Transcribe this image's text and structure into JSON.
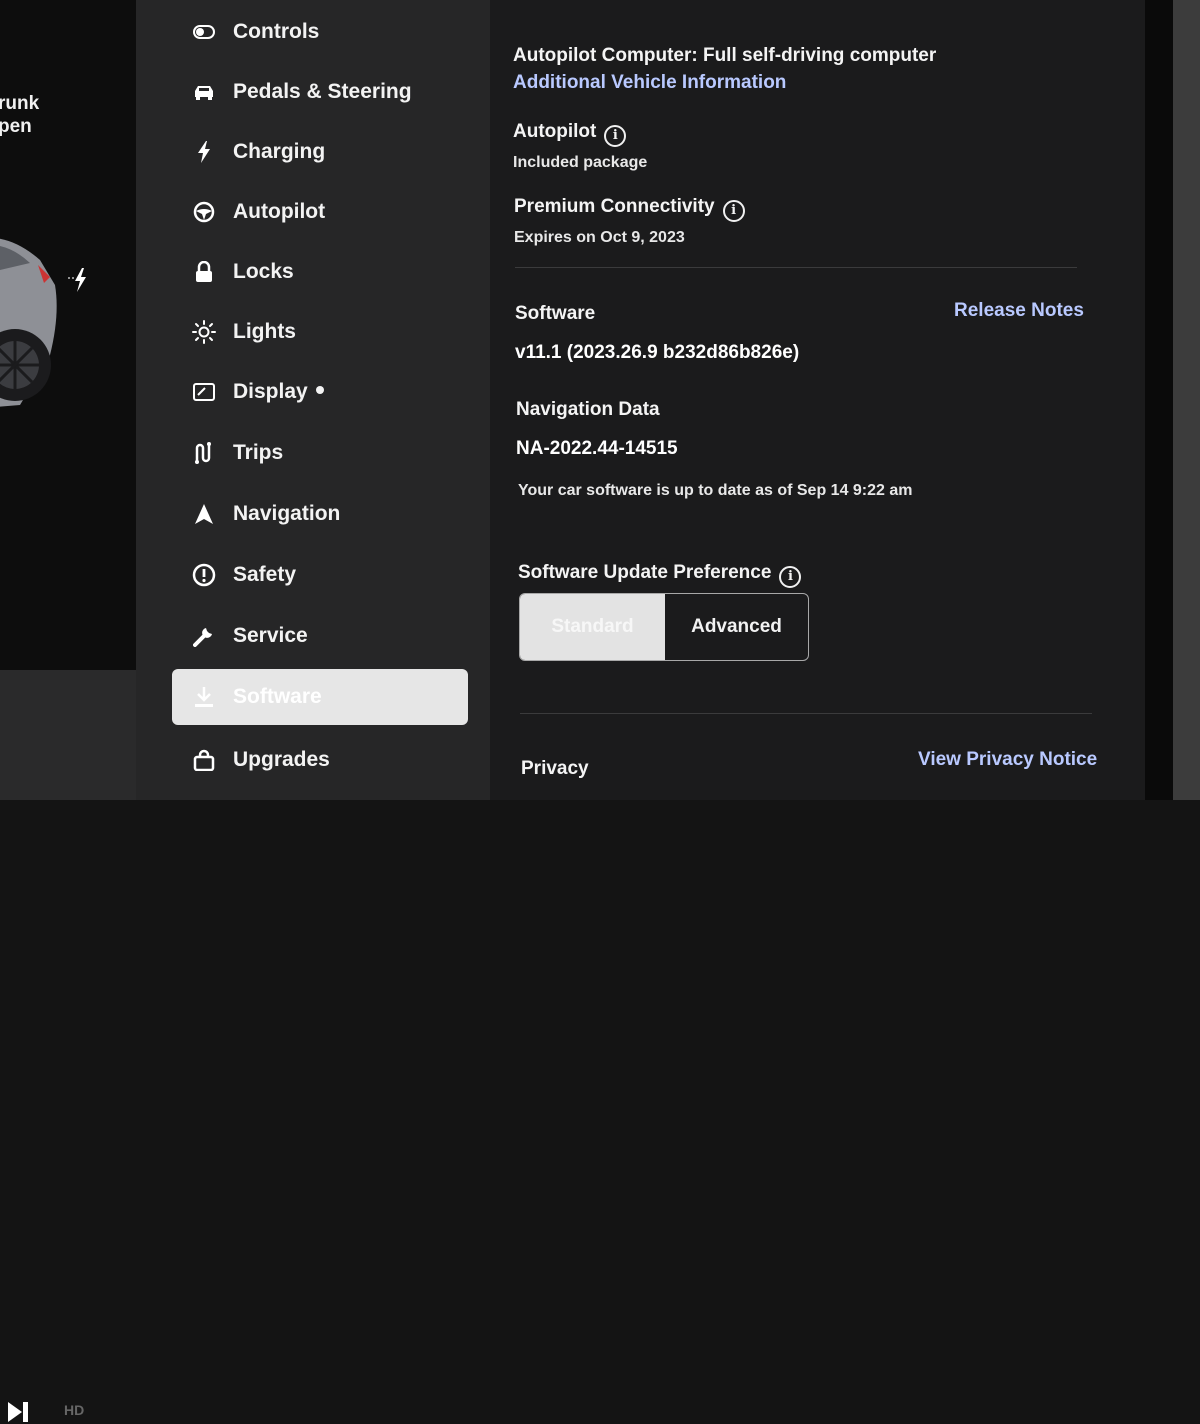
{
  "car_panel": {
    "trunk_label_line1": "runk",
    "trunk_label_line2": "pen"
  },
  "sidebar": {
    "items": [
      {
        "label": "Controls",
        "icon": "toggle-icon"
      },
      {
        "label": "Pedals & Steering",
        "icon": "car-icon"
      },
      {
        "label": "Charging",
        "icon": "bolt-icon"
      },
      {
        "label": "Autopilot",
        "icon": "steering-wheel-icon"
      },
      {
        "label": "Locks",
        "icon": "lock-icon"
      },
      {
        "label": "Lights",
        "icon": "sun-icon"
      },
      {
        "label": "Display",
        "icon": "display-icon"
      },
      {
        "label": "Trips",
        "icon": "trips-icon"
      },
      {
        "label": "Navigation",
        "icon": "navigation-arrow-icon"
      },
      {
        "label": "Safety",
        "icon": "alert-icon"
      },
      {
        "label": "Service",
        "icon": "wrench-icon"
      },
      {
        "label": "Software",
        "icon": "download-icon",
        "active": true
      },
      {
        "label": "Upgrades",
        "icon": "bag-icon"
      }
    ]
  },
  "main": {
    "autopilot_computer": "Autopilot Computer: Full self-driving computer",
    "additional_info_link": "Additional Vehicle Information",
    "autopilot_title": "Autopilot",
    "autopilot_value": "Included package",
    "connectivity_title": "Premium Connectivity",
    "connectivity_value": "Expires on Oct 9, 2023",
    "software_title": "Software",
    "release_notes_link": "Release Notes",
    "software_version": "v11.1 (2023.26.9 b232d86b826e)",
    "nav_data_title": "Navigation Data",
    "nav_data_value": "NA-2022.44-14515",
    "update_status": "Your car software is up to date as of Sep 14 9:22 am",
    "update_pref_title": "Software Update Preference",
    "update_pref_options": [
      "Standard",
      "Advanced"
    ],
    "update_pref_selected": "Standard",
    "privacy_title": "Privacy",
    "privacy_link": "View Privacy Notice"
  },
  "colors": {
    "link": "#b9c9ff",
    "active_item_bg": "#e6e6e6",
    "sidebar_bg": "#262627",
    "main_bg": "#1b1b1c"
  }
}
